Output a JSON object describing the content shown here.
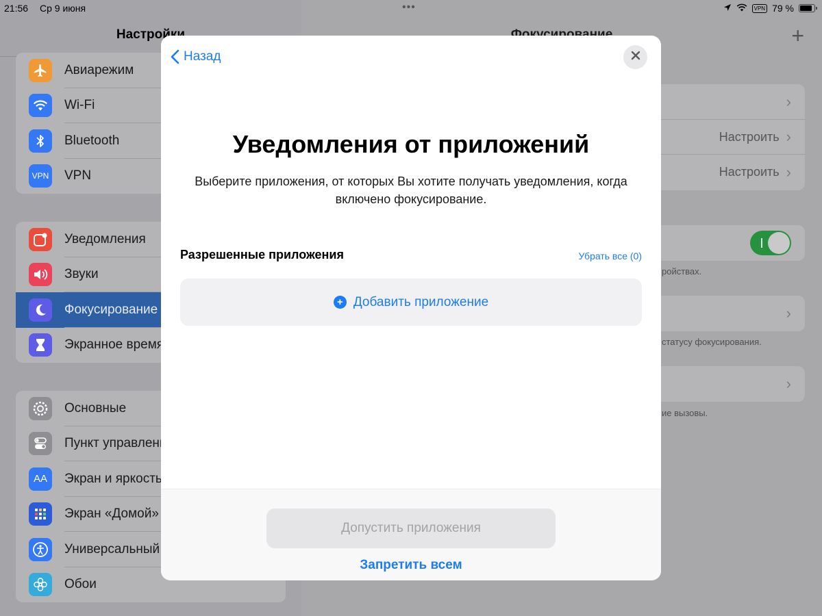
{
  "status_bar": {
    "time": "21:56",
    "date": "Ср 9 июня",
    "vpn": "VPN",
    "battery": "79 %"
  },
  "sidebar": {
    "title": "Настройки",
    "groups": [
      [
        {
          "label": "Авиарежим",
          "icon": "airplane-icon",
          "color": "#f09a37"
        },
        {
          "label": "Wi-Fi",
          "icon": "wifi-icon",
          "color": "#3478f6"
        },
        {
          "label": "Bluetooth",
          "icon": "bluetooth-icon",
          "color": "#3478f6"
        },
        {
          "label": "VPN",
          "icon": "vpn-icon",
          "color": "#3478f6"
        }
      ],
      [
        {
          "label": "Уведомления",
          "icon": "notifications-icon",
          "color": "#eb4d3d"
        },
        {
          "label": "Звуки",
          "icon": "sounds-icon",
          "color": "#eb445a"
        },
        {
          "label": "Фокусирование",
          "icon": "moon-icon",
          "color": "#5e5ce6",
          "active": true
        },
        {
          "label": "Экранное время",
          "icon": "hourglass-icon",
          "color": "#5e5ce6"
        }
      ],
      [
        {
          "label": "Основные",
          "icon": "gear-icon",
          "color": "#8e8e93"
        },
        {
          "label": "Пункт управления",
          "icon": "switches-icon",
          "color": "#8e8e93"
        },
        {
          "label": "Экран и яркость",
          "icon": "text-size-icon",
          "color": "#3478f6"
        },
        {
          "label": "Экран «Домой»",
          "icon": "home-grid-icon",
          "color": "#2e5bd8"
        },
        {
          "label": "Универсальный",
          "icon": "accessibility-icon",
          "color": "#3478f6"
        },
        {
          "label": "Обои",
          "icon": "flower-icon",
          "color": "#35aadc"
        }
      ]
    ]
  },
  "detail": {
    "title": "Фокусирование",
    "rows": {
      "configure_1": "Настроить",
      "configure_2": "Настроить"
    },
    "footers": {
      "devices": "ройствах.",
      "status": "статусу фокусирования.",
      "calls": "ие вызовы."
    },
    "toggle_on": true
  },
  "modal": {
    "back_label": "Назад",
    "title": "Уведомления от приложений",
    "subtitle": "Выберите приложения, от которых Вы хотите получать уведомления, когда включено фокусирование.",
    "section_title": "Разрешенные приложения",
    "remove_all": "Убрать все (0)",
    "add_app": "Добавить приложение",
    "allow_button": "Допустить приложения",
    "deny_all": "Запретить всем"
  }
}
